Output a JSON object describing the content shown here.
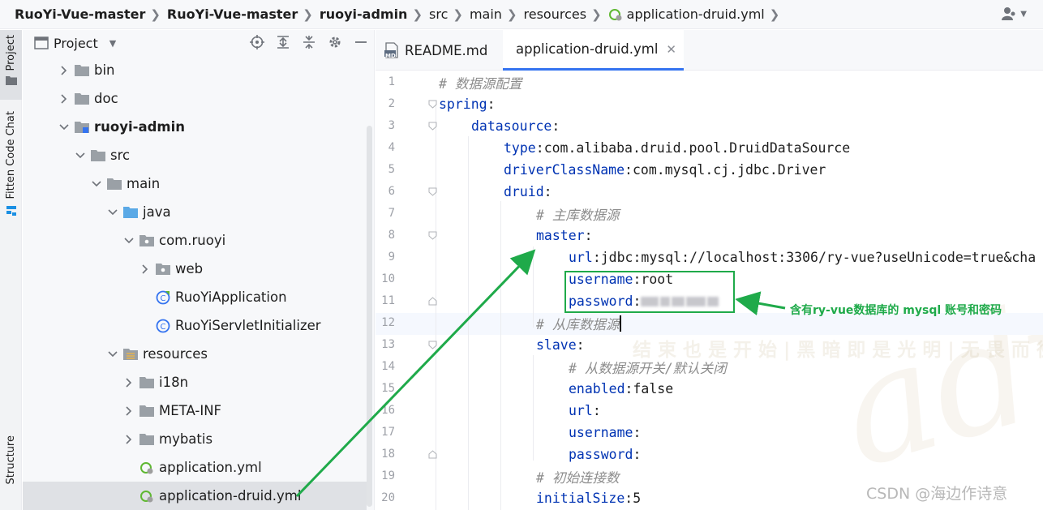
{
  "breadcrumb": {
    "items": [
      "RuoYi-Vue-master",
      "RuoYi-Vue-master",
      "ruoyi-admin",
      "src",
      "main",
      "resources",
      "application-druid.yml"
    ]
  },
  "sidebar_strip": {
    "project": "Project",
    "fitten": "Fitten Code Chat",
    "structure": "Structure"
  },
  "project_panel": {
    "title": "Project",
    "tree": [
      {
        "label": "bin",
        "type": "folder"
      },
      {
        "label": "doc",
        "type": "folder"
      },
      {
        "label": "ruoyi-admin",
        "type": "module"
      },
      {
        "label": "src",
        "type": "folder"
      },
      {
        "label": "main",
        "type": "folder"
      },
      {
        "label": "java",
        "type": "source-folder"
      },
      {
        "label": "com.ruoyi",
        "type": "package"
      },
      {
        "label": "web",
        "type": "package"
      },
      {
        "label": "RuoYiApplication",
        "type": "class"
      },
      {
        "label": "RuoYiServletInitializer",
        "type": "class"
      },
      {
        "label": "resources",
        "type": "resources-folder"
      },
      {
        "label": "i18n",
        "type": "package"
      },
      {
        "label": "META-INF",
        "type": "package"
      },
      {
        "label": "mybatis",
        "type": "package"
      },
      {
        "label": "application.yml",
        "type": "yaml"
      },
      {
        "label": "application-druid.yml",
        "type": "yaml"
      }
    ]
  },
  "tabs": [
    {
      "label": "README.md",
      "icon_text": "MD",
      "active": false
    },
    {
      "label": "application-druid.yml",
      "active": true
    }
  ],
  "editor": {
    "line_numbers": [
      "1",
      "2",
      "3",
      "4",
      "5",
      "6",
      "7",
      "8",
      "9",
      "10",
      "11",
      "12",
      "13",
      "14",
      "15",
      "16",
      "17",
      "18",
      "19",
      "20"
    ],
    "lines": {
      "l1": "# 数据源配置",
      "l2_key": "spring",
      "l3_key": "datasource",
      "l4_key": "type",
      "l4_val": "com.alibaba.druid.pool.DruidDataSource",
      "l5_key": "driverClassName",
      "l5_val": "com.mysql.cj.jdbc.Driver",
      "l6_key": "druid",
      "l7": "# 主库数据源",
      "l8_key": "master",
      "l9_key": "url",
      "l9_val": "jdbc:mysql://localhost:3306/ry-vue?useUnicode=true&cha",
      "l10_key": "username",
      "l10_val": "root",
      "l11_key": "password",
      "l12": "# 从库数据源",
      "l13_key": "slave",
      "l14": "# 从数据源开关/默认关闭",
      "l15_key": "enabled",
      "l15_val": "false",
      "l16_key": "url",
      "l17_key": "username",
      "l18_key": "password",
      "l19": "# 初始连接数",
      "l20_key": "initialSize",
      "l20_val": "5"
    },
    "colon": ":"
  },
  "watermark": {
    "motto": "结束也是开始|黑暗即是光明|无畏而往"
  },
  "annotation": {
    "text": "含有ry-vue数据库的 mysql 账号和密码",
    "color": "#1faa4a"
  },
  "footer_watermark": "CSDN @海边作诗意",
  "colors": {
    "key": "#0033b3",
    "comment": "#8c8c8c",
    "accent": "#3574f0"
  }
}
